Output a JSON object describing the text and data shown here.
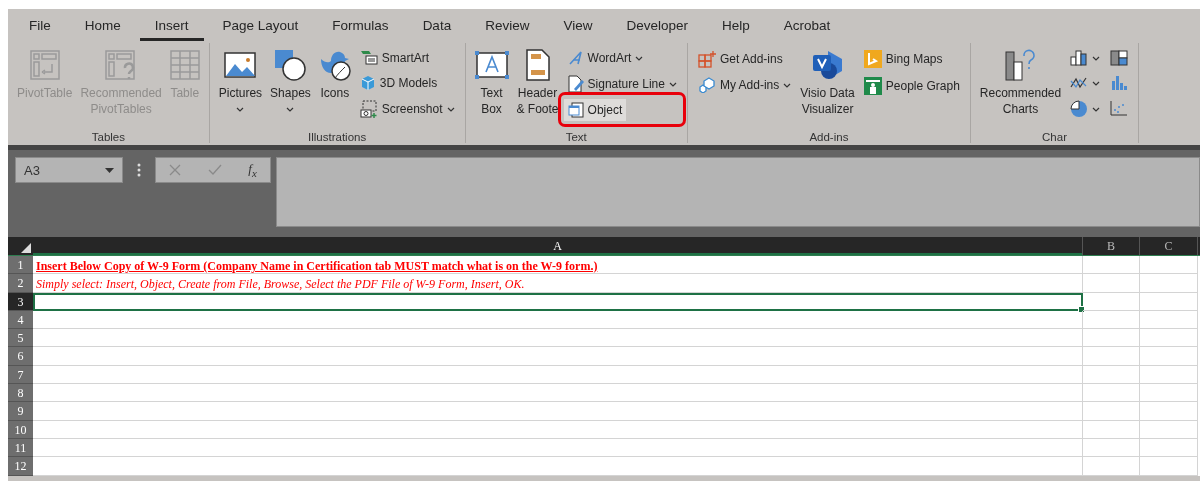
{
  "ribbon_tabs": [
    {
      "label": "File",
      "selected": false
    },
    {
      "label": "Home",
      "selected": false
    },
    {
      "label": "Insert",
      "selected": true
    },
    {
      "label": "Page Layout",
      "selected": false
    },
    {
      "label": "Formulas",
      "selected": false
    },
    {
      "label": "Data",
      "selected": false
    },
    {
      "label": "Review",
      "selected": false
    },
    {
      "label": "View",
      "selected": false
    },
    {
      "label": "Developer",
      "selected": false
    },
    {
      "label": "Help",
      "selected": false
    },
    {
      "label": "Acrobat",
      "selected": false
    }
  ],
  "ribbon_groups": [
    {
      "label": "Tables",
      "columns": [
        {
          "kind": "large",
          "lines": [
            "PivotTable"
          ],
          "disabled": true,
          "dropdown": false
        },
        {
          "kind": "large",
          "lines": [
            "Recommended",
            "PivotTables"
          ],
          "disabled": true,
          "dropdown": false
        },
        {
          "kind": "large",
          "lines": [
            "Table"
          ],
          "disabled": true,
          "dropdown": false
        }
      ]
    },
    {
      "label": "Illustrations",
      "columns": [
        {
          "kind": "large",
          "lines": [
            "Pictures"
          ],
          "disabled": false,
          "dropdown": true
        },
        {
          "kind": "large",
          "lines": [
            "Shapes"
          ],
          "disabled": false,
          "dropdown": true
        },
        {
          "kind": "large",
          "lines": [
            "Icons"
          ],
          "disabled": false,
          "dropdown": false
        },
        {
          "kind": "stack",
          "items": [
            {
              "label": "SmartArt",
              "dropdown": false,
              "highlighted": false
            },
            {
              "label": "3D Models",
              "dropdown": false,
              "highlighted": false
            },
            {
              "label": "Screenshot",
              "dropdown": true,
              "highlighted": false
            }
          ]
        }
      ]
    },
    {
      "label": "Text",
      "columns": [
        {
          "kind": "large",
          "lines": [
            "Text",
            "Box"
          ],
          "disabled": false,
          "dropdown": false
        },
        {
          "kind": "large",
          "lines": [
            "Header",
            "& Foote"
          ],
          "disabled": false,
          "dropdown": false
        },
        {
          "kind": "stack",
          "items": [
            {
              "label": "WordArt",
              "dropdown": true,
              "highlighted": false
            },
            {
              "label": "Signature Line",
              "dropdown": true,
              "highlighted": false
            },
            {
              "label": "Object",
              "dropdown": false,
              "highlighted": true
            }
          ]
        }
      ]
    },
    {
      "label": "Add-ins",
      "columns": [
        {
          "kind": "stack",
          "items": [
            {
              "label": "Get Add-ins",
              "dropdown": false,
              "highlighted": false
            },
            {
              "label": "My Add-ins",
              "dropdown": true,
              "highlighted": false
            }
          ]
        },
        {
          "kind": "large",
          "lines": [
            "Visio Data",
            "Visualizer"
          ],
          "disabled": false,
          "dropdown": false
        },
        {
          "kind": "stack",
          "items": [
            {
              "label": "Bing Maps",
              "dropdown": false,
              "highlighted": false
            },
            {
              "label": "People Graph",
              "dropdown": false,
              "highlighted": false
            }
          ]
        }
      ]
    },
    {
      "label": "Char",
      "columns": [
        {
          "kind": "large",
          "lines": [
            "Recommended",
            "Charts"
          ],
          "disabled": false,
          "dropdown": false
        },
        {
          "kind": "stack",
          "items": [
            {
              "dropdown": true,
              "highlighted": false
            },
            {
              "dropdown": true,
              "highlighted": false
            },
            {
              "dropdown": true,
              "highlighted": false
            }
          ]
        },
        {
          "kind": "stack",
          "items": [
            {
              "dropdown": false,
              "highlighted": false
            },
            {
              "dropdown": false,
              "highlighted": false
            },
            {
              "dropdown": false,
              "highlighted": false
            }
          ]
        }
      ]
    }
  ],
  "formula_bar": {
    "name_box": "A3",
    "function_label": "f$_{x}$"
  },
  "sheet": {
    "columns": [
      {
        "label": "A",
        "selected": true
      },
      {
        "label": "B",
        "selected": false
      },
      {
        "label": "C",
        "selected": false
      }
    ],
    "rows": [
      {
        "header": "1",
        "selected": false,
        "cell": {
          "text": "Insert Below Copy of W-9 Form (Company Name in Certification tab MUST match what is on the W-9 form.)",
          "kind": "bold-underline"
        }
      },
      {
        "header": "2",
        "selected": false,
        "cell": {
          "text": "Simply select: Insert, Object, Create from File, Browse, Select the PDF File of W-9 Form, Insert, OK.",
          "kind": "italic"
        }
      },
      {
        "header": "3",
        "selected": true
      },
      {
        "header": "4",
        "selected": false
      },
      {
        "header": "5",
        "selected": false
      },
      {
        "header": "6",
        "selected": false
      },
      {
        "header": "7",
        "selected": false
      },
      {
        "header": "8",
        "selected": false
      },
      {
        "header": "9",
        "selected": false
      },
      {
        "header": "10",
        "selected": false
      },
      {
        "header": "11",
        "selected": false
      },
      {
        "header": "12",
        "selected": false
      }
    ]
  }
}
